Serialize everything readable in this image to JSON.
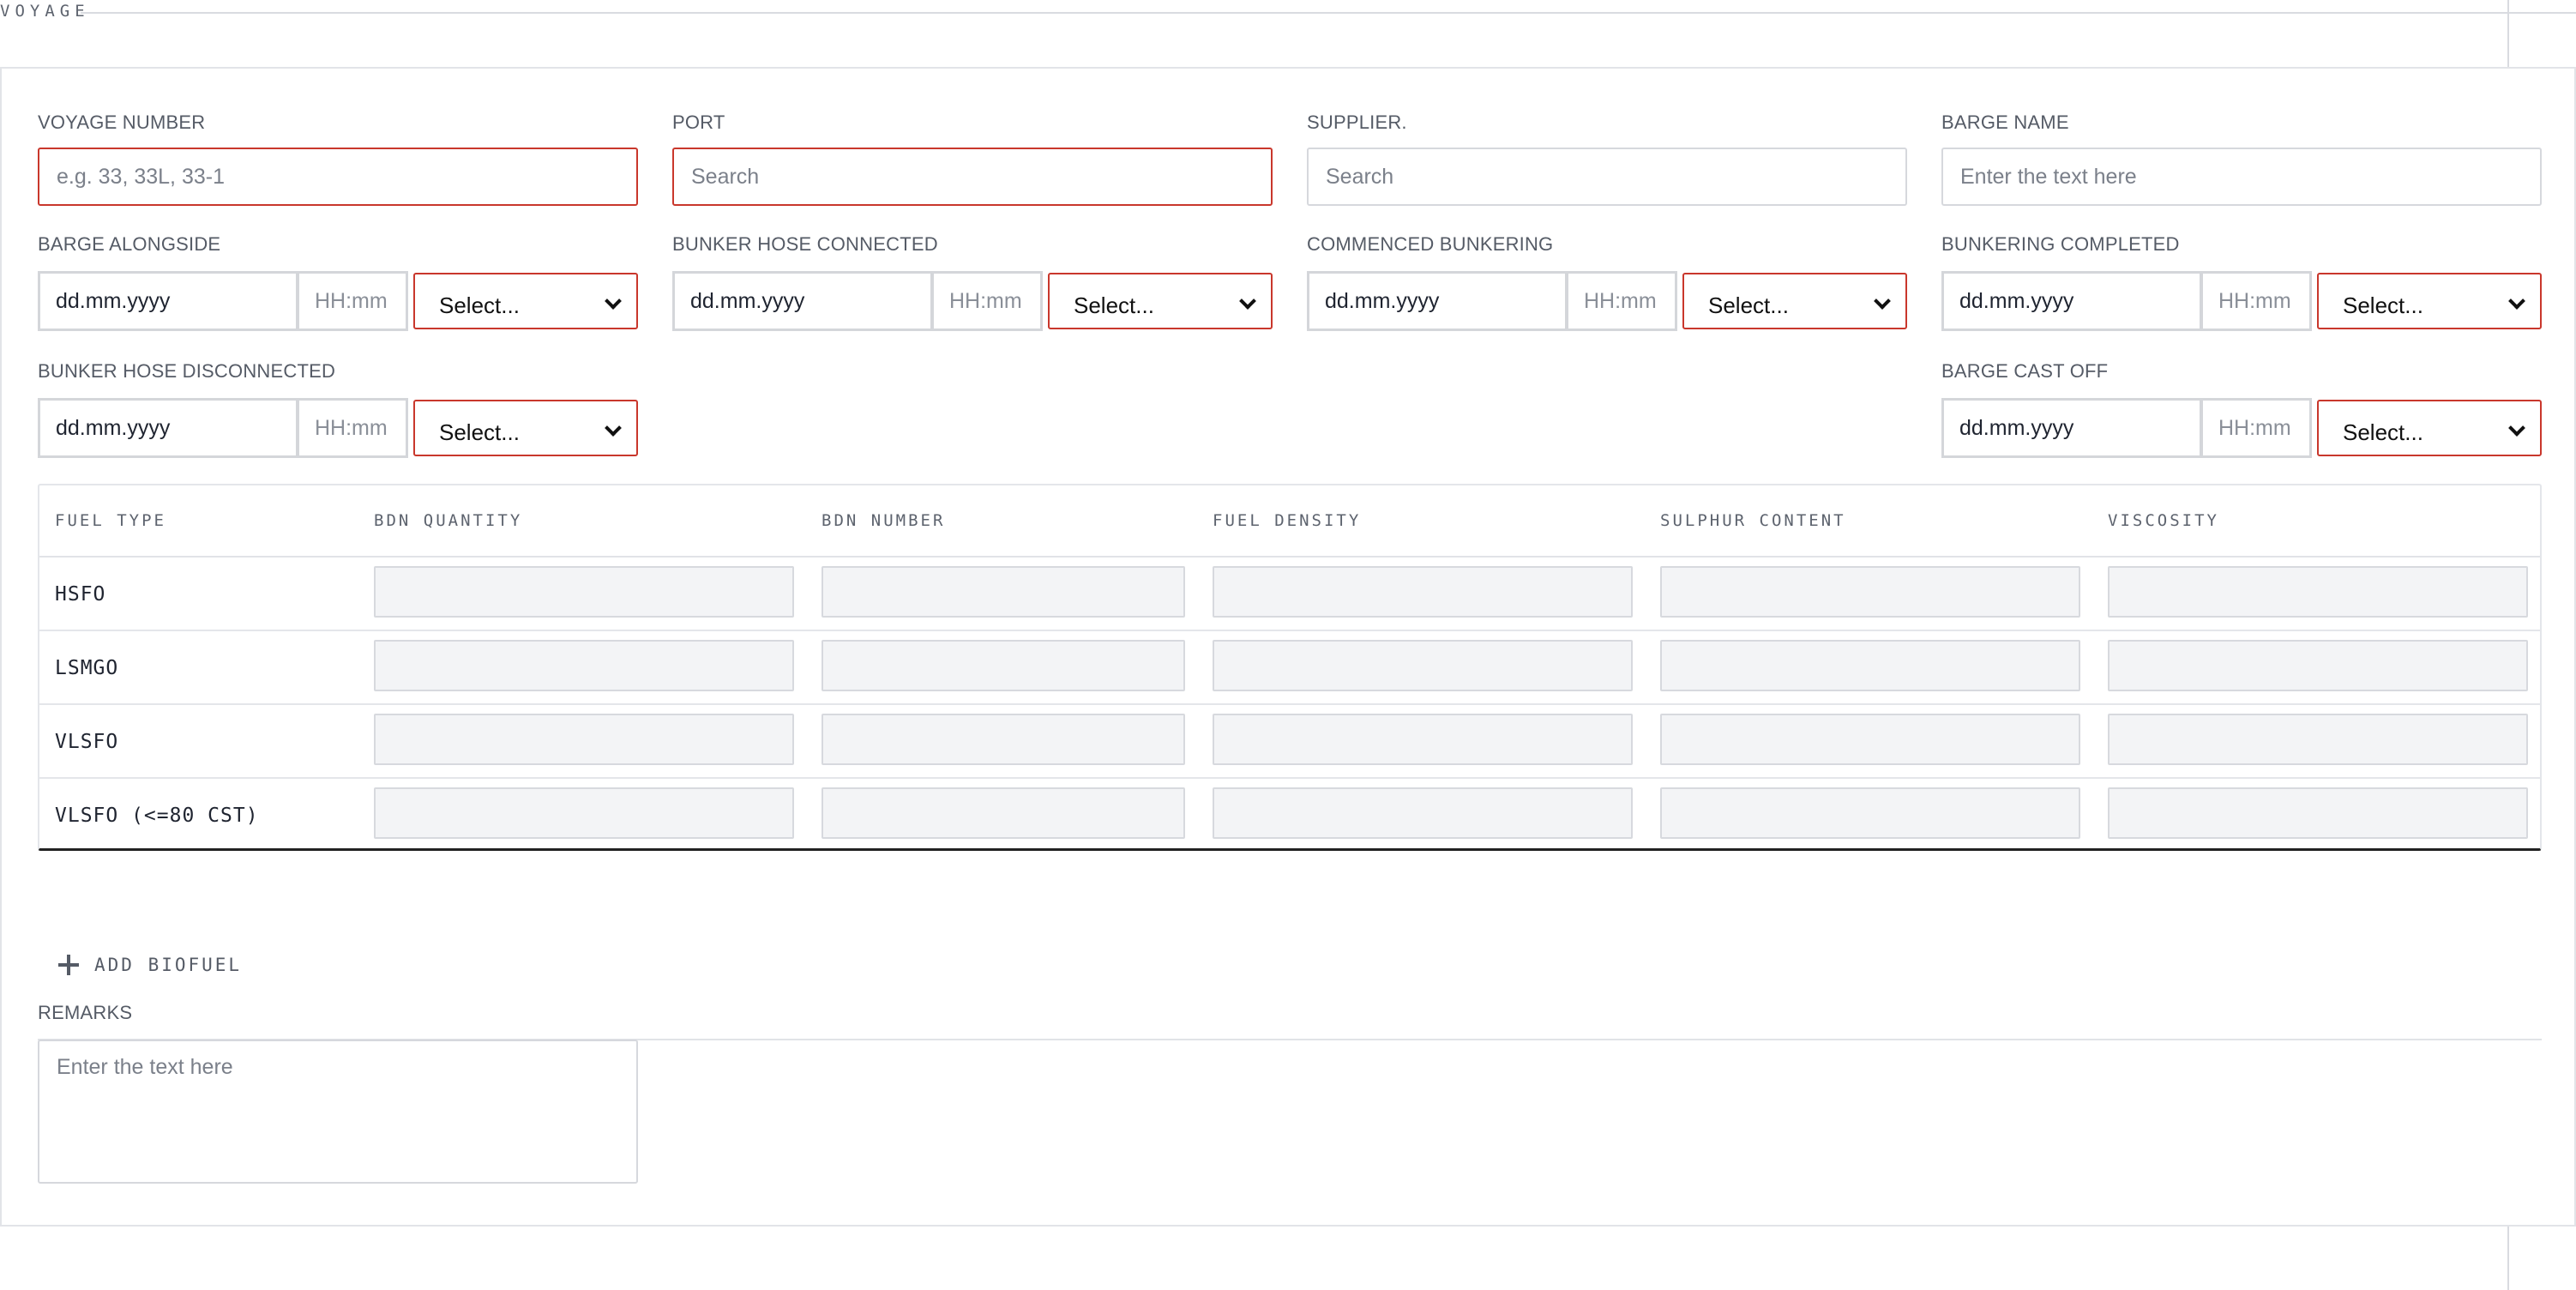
{
  "section_title": "VOYAGE",
  "fields": {
    "voyage_number": {
      "label": "VOYAGE NUMBER",
      "placeholder": "e.g. 33, 33L, 33-1"
    },
    "port": {
      "label": "PORT",
      "placeholder": "Search"
    },
    "supplier": {
      "label": "SUPPLIER.",
      "placeholder": "Search"
    },
    "barge_name": {
      "label": "BARGE NAME",
      "placeholder": "Enter the text here"
    }
  },
  "datetime_fields": {
    "barge_alongside": {
      "label": "BARGE ALONGSIDE",
      "date_placeholder": "dd.mm.yyyy",
      "time_placeholder": "HH:mm",
      "select_value": "Select..."
    },
    "bunker_hose_connected": {
      "label": "BUNKER HOSE CONNECTED",
      "date_placeholder": "dd.mm.yyyy",
      "time_placeholder": "HH:mm",
      "select_value": "Select..."
    },
    "commenced_bunkering": {
      "label": "COMMENCED BUNKERING",
      "date_placeholder": "dd.mm.yyyy",
      "time_placeholder": "HH:mm",
      "select_value": "Select..."
    },
    "bunkering_completed": {
      "label": "BUNKERING COMPLETED",
      "date_placeholder": "dd.mm.yyyy",
      "time_placeholder": "HH:mm",
      "select_value": "Select..."
    },
    "bunker_hose_disconnected": {
      "label": "BUNKER HOSE DISCONNECTED",
      "date_placeholder": "dd.mm.yyyy",
      "time_placeholder": "HH:mm",
      "select_value": "Select..."
    },
    "barge_cast_off": {
      "label": "BARGE CAST OFF",
      "date_placeholder": "dd.mm.yyyy",
      "time_placeholder": "HH:mm",
      "select_value": "Select..."
    }
  },
  "fuel_table": {
    "columns": [
      "FUEL TYPE",
      "BDN QUANTITY",
      "BDN NUMBER",
      "FUEL DENSITY",
      "SULPHUR CONTENT",
      "VISCOSITY"
    ],
    "rows": [
      "HSFO",
      "LSMGO",
      "VLSFO",
      "VLSFO (<=80 CST)"
    ]
  },
  "add_biofuel_label": "ADD BIOFUEL",
  "remarks": {
    "label": "REMARKS",
    "placeholder": "Enter the text here"
  },
  "colors": {
    "error_border": "#c9372c",
    "input_border": "#d6d8dd",
    "cell_fill": "#f3f4f6"
  }
}
